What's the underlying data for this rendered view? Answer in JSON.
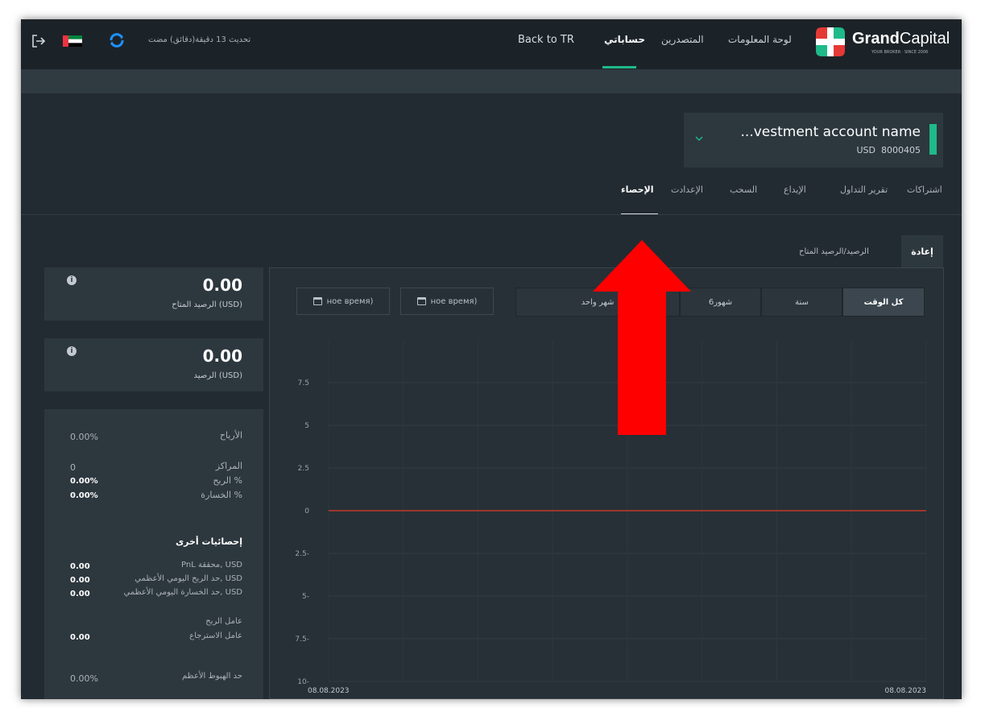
{
  "header": {
    "logo_bold": "Grand",
    "logo_light": "Capital",
    "logo_tagline": "YOUR BROKER · SINCE 2006",
    "nav": [
      "لوحة المعلومات",
      "المتصدرين",
      "حساباتي",
      "Back to TR"
    ],
    "update_text": "تحديث 13 دقيقة(دقائق) مضت"
  },
  "account": {
    "name": "...vestment account name",
    "currency": "USD",
    "number": "8000405"
  },
  "tabs": [
    "اشتراكات",
    "تقرير التداول",
    "الإيداع",
    "السحب",
    "الإعدادت",
    "الإحصاء"
  ],
  "subtabs": {
    "reset": "إعادة",
    "balance": "الرصيد/الرصيد المتاح"
  },
  "ranges": [
    "كل الوقت",
    "سنة",
    "6شهور",
    "شهر واحد"
  ],
  "dates": [
    "ное время)",
    "ное время)"
  ],
  "cards": [
    {
      "value": "0.00",
      "label": "الرصيد المتاح (USD)"
    },
    {
      "value": "0.00",
      "label": "الرصيد (USD)"
    }
  ],
  "stats": [
    {
      "label": "الأرباح",
      "value": "0.00%"
    },
    {
      "label": "المراكز",
      "value": "0"
    },
    {
      "label": "الربح %",
      "value": "0.00%"
    },
    {
      "label": "الخسارة %",
      "value": "0.00%"
    }
  ],
  "other_stats_title": "إحصائيات أخرى",
  "other_stats": [
    {
      "label": "PnL محققة, USD",
      "value": "0.00"
    },
    {
      "label": "حد الربح اليومي الأعظمي, USD",
      "value": "0.00"
    },
    {
      "label": "حد الخسارة اليومي الأعظمي, USD",
      "value": "0.00"
    },
    {
      "label": "عامل الربح",
      "value": ""
    },
    {
      "label": "عامل الاسترجاع",
      "value": "0.00"
    },
    {
      "label": "حد الهبوط الأعظم",
      "value": "0.00%"
    }
  ],
  "colors": {
    "accent": "#1fb98a",
    "arrow": "#ff0000",
    "line": "#c0392b"
  },
  "chart_data": {
    "type": "line",
    "x": [
      "08.08.2023",
      "08.08.2023"
    ],
    "series": [
      {
        "values": [
          0,
          0
        ]
      }
    ],
    "y_ticks": [
      "7.5",
      "5",
      "2.5",
      "0",
      "-2.5",
      "-5",
      "-7.5",
      "-10"
    ],
    "x_ticks": [
      "08.08.2023",
      "08.08.2023"
    ],
    "ylim": [
      -10,
      10
    ],
    "grid": true
  }
}
